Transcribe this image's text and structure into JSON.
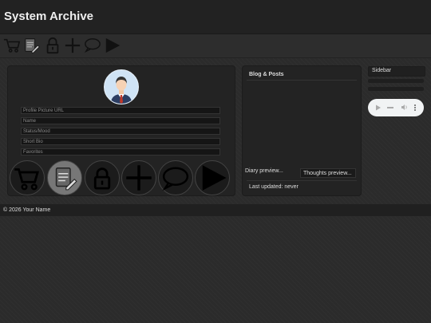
{
  "header": {
    "title": "System Archive"
  },
  "toolbar": {
    "icons": [
      "cart-icon",
      "edit-document-icon",
      "lock-icon",
      "plus-icon",
      "speech-bubble-icon",
      "play-icon"
    ]
  },
  "profile": {
    "avatar_icon": "user-avatar-icon",
    "fields": [
      {
        "placeholder": "Profile Picture URL",
        "value": ""
      },
      {
        "placeholder": "Name",
        "value": ""
      },
      {
        "placeholder": "Status/Mood",
        "value": ""
      },
      {
        "placeholder": "Short Bio",
        "value": ""
      },
      {
        "placeholder": "Favorites",
        "value": ""
      }
    ]
  },
  "blog": {
    "title": "Blog & Posts",
    "diary_preview": "Diary preview...",
    "thoughts_preview": "Thoughts preview...",
    "last_updated": "Last updated: never"
  },
  "sidebar": {
    "label": "Sidebar"
  },
  "audio": {
    "icons": [
      "play-icon",
      "volume-icon",
      "more-options-icon"
    ]
  },
  "footer": {
    "text": "© 2026 Your Name"
  },
  "colors": {
    "background": "#2b2b2b",
    "panel": "#232323",
    "header": "#222222",
    "audio_bg": "#f1f3f4"
  }
}
